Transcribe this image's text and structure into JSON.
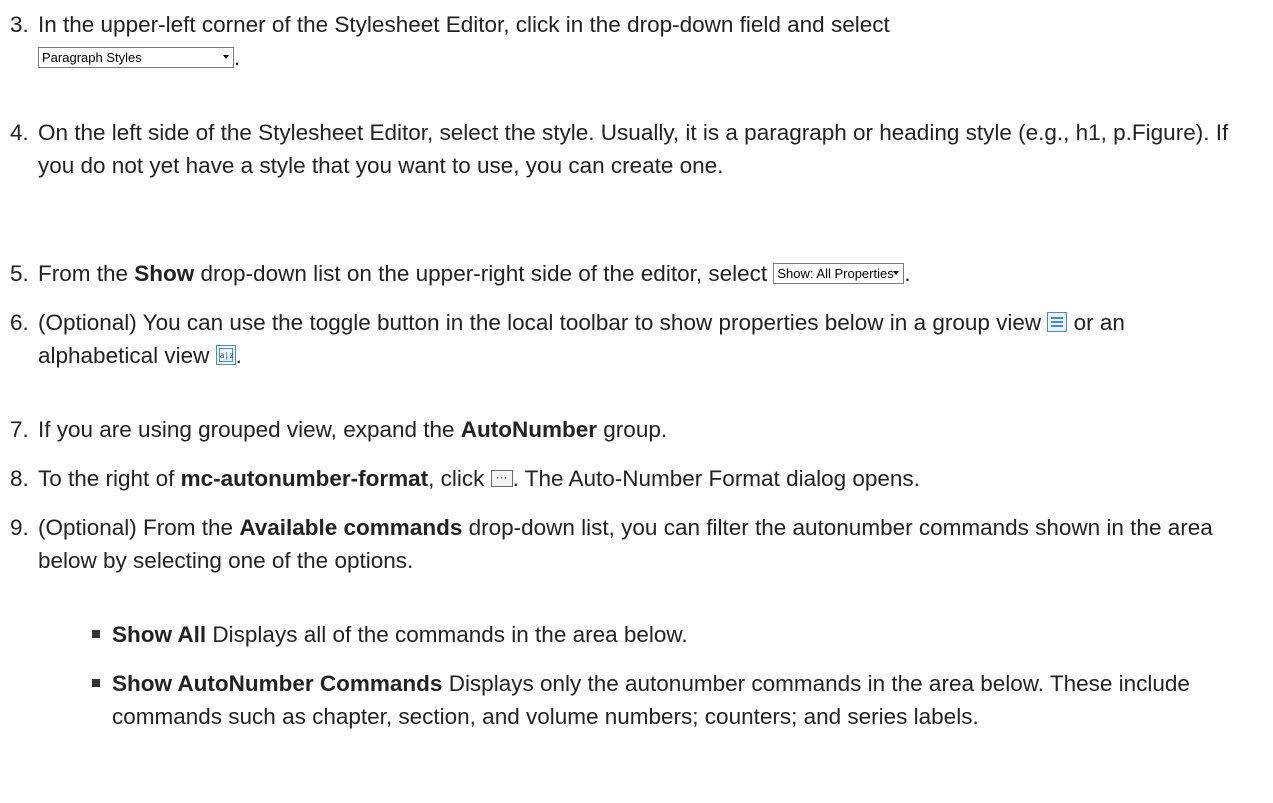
{
  "steps": [
    {
      "number": "3.",
      "text_1": "In the upper-left corner of the Stylesheet Editor, click in the drop-down field and select",
      "dropdown_label": "Paragraph Styles",
      "text_2": "."
    },
    {
      "number": "4.",
      "text": "On the left side of the Stylesheet Editor, select the style. Usually, it is a paragraph or heading style (e.g., h1, p.Figure). If you do not yet have a style that you want to use, you can create one."
    },
    {
      "number": "5.",
      "text_1": "From the ",
      "bold_1": "Show",
      "text_2": " drop-down list on the upper-right side of the editor, select ",
      "dropdown_label": "Show: All Properties",
      "text_3": "."
    },
    {
      "number": "6.",
      "text_1": "(Optional) You can use the toggle button in the local toolbar to show properties below in a group view ",
      "text_2": " or an alphabetical view ",
      "alpha_icon_text": "a|z",
      "text_3": "."
    },
    {
      "number": "7.",
      "text_1": "If you are using grouped view, expand the ",
      "bold_1": "AutoNumber",
      "text_2": " group."
    },
    {
      "number": "8.",
      "text_1": "To the right of ",
      "bold_1": "mc-autonumber-format",
      "text_2": ", click ",
      "ellipsis_text": "···",
      "text_3": ". The Auto-Number Format dialog opens."
    },
    {
      "number": "9.",
      "text_1": "(Optional) From the ",
      "bold_1": "Available commands",
      "text_2": " drop-down list, you can filter the autonumber commands shown in the area below by selecting one of the options."
    }
  ],
  "bullets": [
    {
      "bold": "Show All",
      "text": " Displays all of the commands in the area below."
    },
    {
      "bold": "Show AutoNumber Commands",
      "text": " Displays only the autonumber commands in the area below. These include commands such as chapter, section, and volume numbers; counters; and series labels."
    }
  ]
}
